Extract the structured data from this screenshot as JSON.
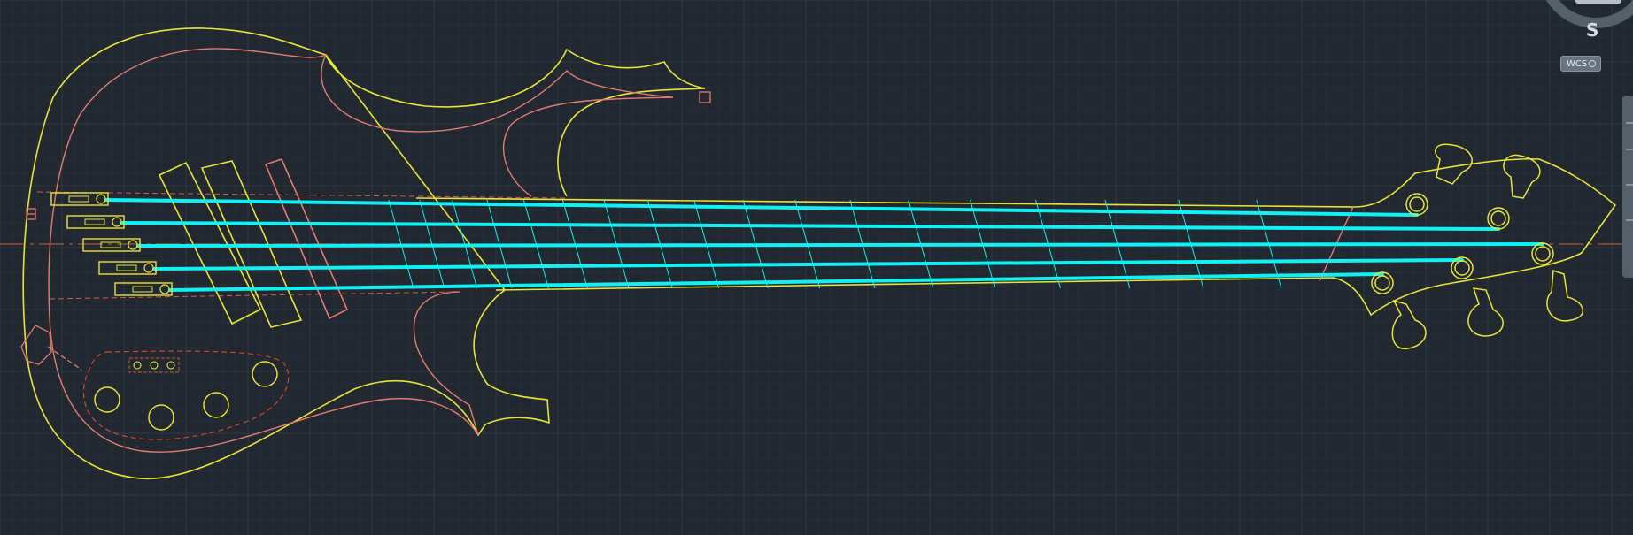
{
  "viewcube": {
    "compass_direction": "S"
  },
  "ucs": {
    "label": "WCS"
  },
  "colors": {
    "background": "#212830",
    "grid_major": "#303a45",
    "grid_minor": "#262e37",
    "outline_yellow": "#e8e43a",
    "outline_salmon": "#e27c72",
    "strings_cyan": "#12f0f4",
    "dashed_red": "#d04a2e",
    "centerline": "#d0603a"
  },
  "drawing": {
    "string_count": 5,
    "tuner_count": 5,
    "knob_count": 4
  }
}
